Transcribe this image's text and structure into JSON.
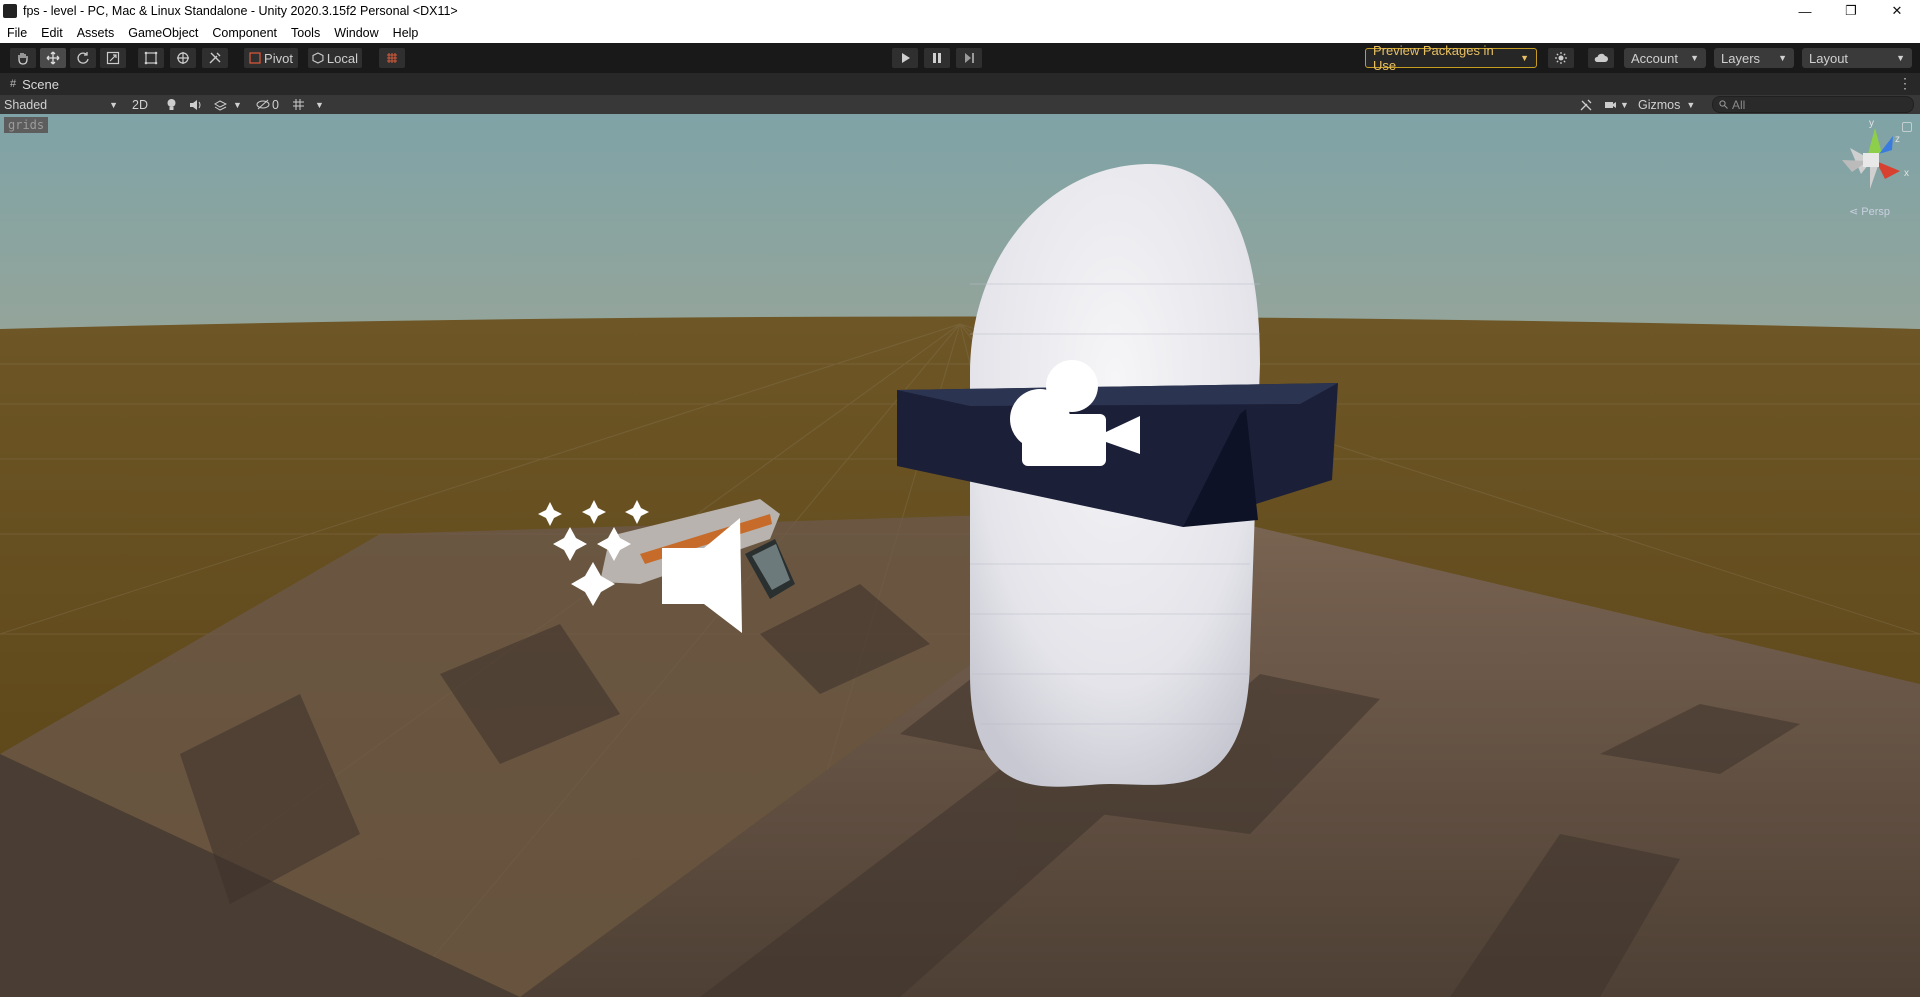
{
  "window": {
    "title": "fps - level - PC, Mac & Linux Standalone - Unity 2020.3.15f2 Personal <DX11>",
    "controls": {
      "minimize": "—",
      "restore": "❐",
      "close": "✕"
    }
  },
  "menu": [
    "File",
    "Edit",
    "Assets",
    "GameObject",
    "Component",
    "Tools",
    "Window",
    "Help"
  ],
  "toolbar": {
    "tools": [
      "hand-tool-icon",
      "move-tool-icon",
      "rotate-tool-icon",
      "scale-tool-icon",
      "rect-tool-icon",
      "transform-tool-icon",
      "custom-tool-icon"
    ],
    "pivot_label": "Pivot",
    "local_label": "Local",
    "play_icon": "play-icon",
    "pause_icon": "pause-icon",
    "step_icon": "step-icon",
    "preview_packages_label": "Preview Packages in Use",
    "account_label": "Account",
    "layers_label": "Layers",
    "layout_label": "Layout",
    "accent_color": "#c59d22"
  },
  "scene_tab": {
    "label": "Scene"
  },
  "scene_toolbar": {
    "draw_mode": "Shaded",
    "mode_2d": "2D",
    "hidden_count": "0",
    "gizmos_label": "Gizmos",
    "search_placeholder": "All"
  },
  "viewport": {
    "grids_label": "grids",
    "projection_label": "Persp",
    "axis_labels": {
      "y": "y",
      "x": "x",
      "z": "z"
    },
    "objects": [
      "capsule-player",
      "visor-box",
      "camera-gizmo-icon",
      "weapon-model",
      "particle-system-gizmo-icon",
      "audio-source-gizmo-icon"
    ]
  }
}
